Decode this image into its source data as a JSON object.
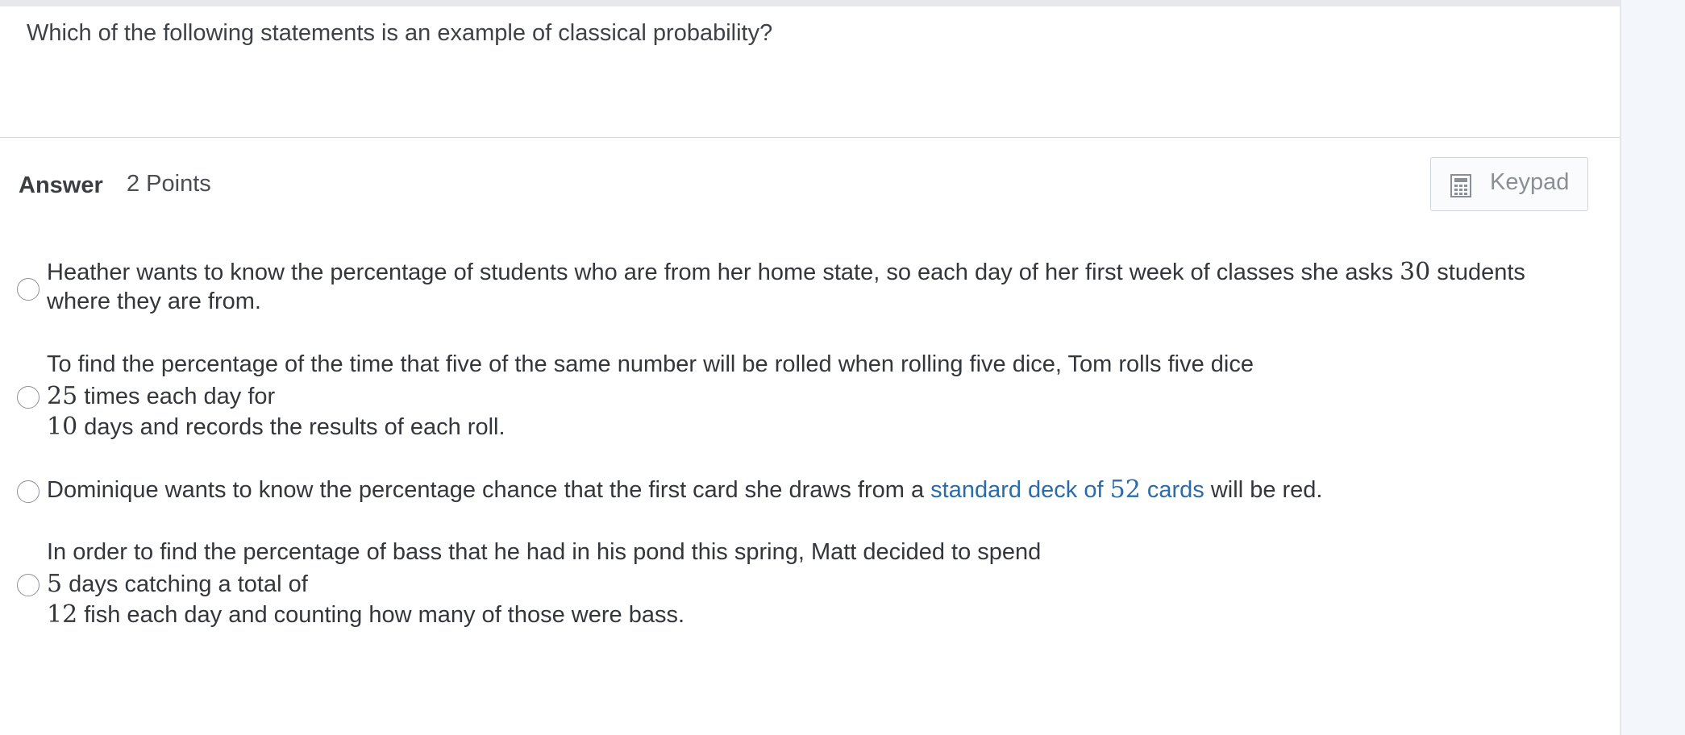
{
  "question": {
    "text": "Which of the following statements is an example of classical probability?"
  },
  "answer": {
    "label": "Answer",
    "points": "2 Points",
    "keypad_label": "Keypad",
    "keypad_icon": "calculator-icon"
  },
  "options": [
    {
      "line1_pre": "Heather wants to know the percentage of students who are from her home state, so each day of her first week of classes she asks",
      "line1_num": "30",
      "line1_post": "students",
      "line2": "where they are from."
    },
    {
      "line1": "To find the percentage of the time that five of the same number will be rolled when rolling five dice, Tom rolls five dice",
      "line2_num": "25",
      "line2_post": "times each day for",
      "line3_num": "10",
      "line3_post": "days and records the results of each roll."
    },
    {
      "pre": "Dominique wants to know the percentage chance that the first card she draws from a",
      "link_pre": "standard deck of",
      "link_num": "52",
      "link_post": "cards",
      "post": "will be red."
    },
    {
      "line1": "In order to find the percentage of bass that he had in his pond this spring, Matt decided to spend",
      "line2_num": "5",
      "line2_post": "days catching a total of",
      "line3_num": "12",
      "line3_post": "fish each day and counting how many of those were bass."
    }
  ],
  "colors": {
    "link": "#2b6ca8",
    "text": "#33363a",
    "background": "#f3f6fb"
  }
}
